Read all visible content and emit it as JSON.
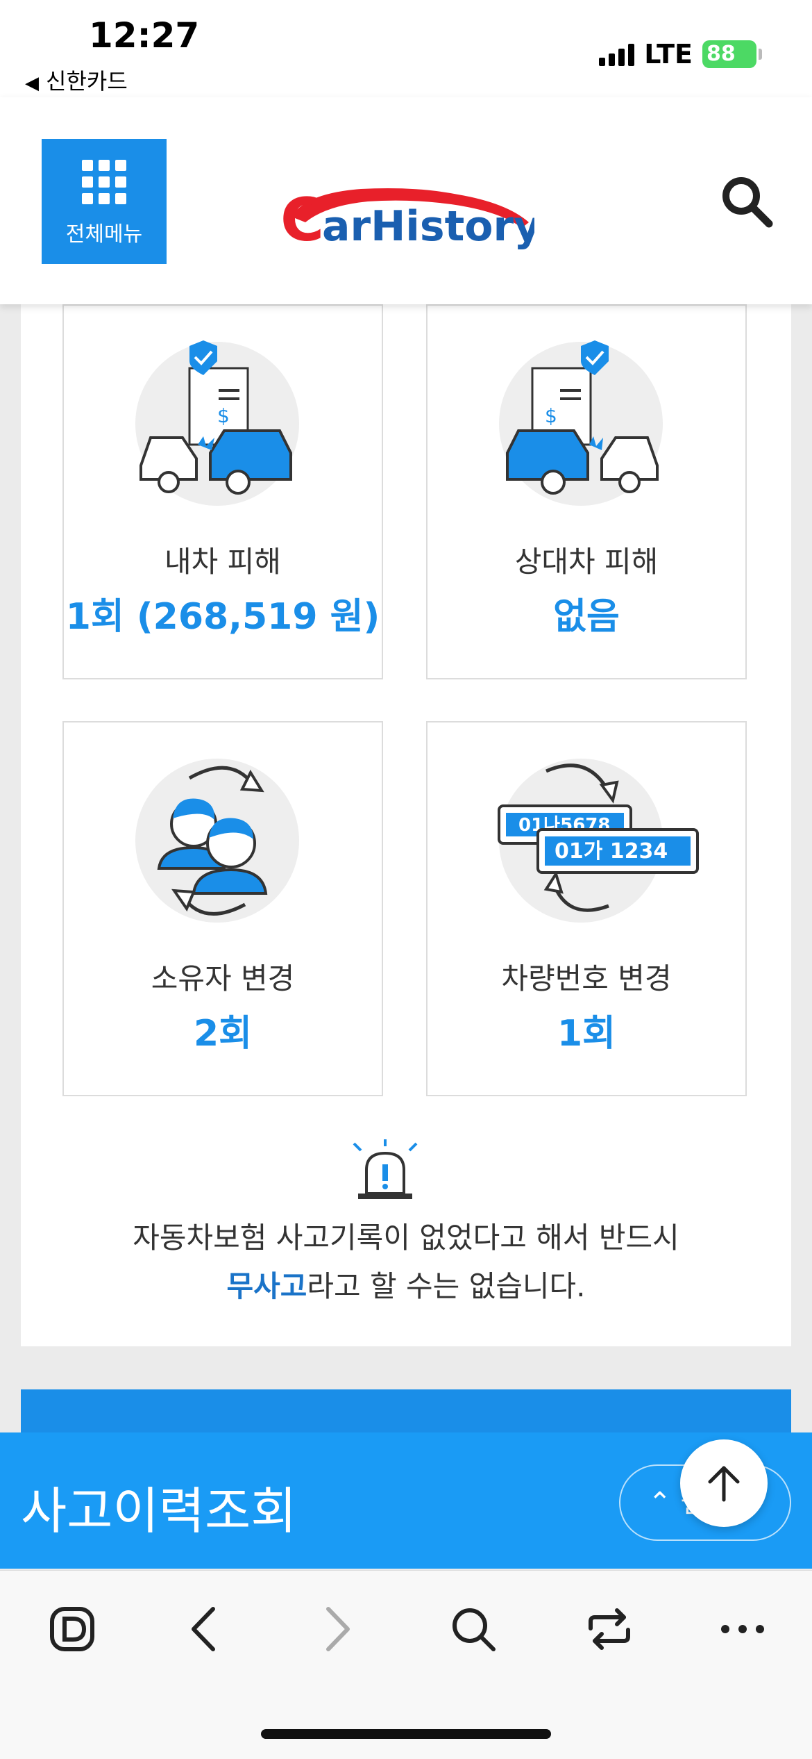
{
  "status_bar": {
    "time": "12:27",
    "back_app": "신한카드",
    "network": "LTE",
    "battery": "88"
  },
  "header": {
    "menu_label": "전체메뉴",
    "logo_text": "CarHistory"
  },
  "stats": [
    {
      "label": "내차 피해",
      "value": "1회 (268,519 원)",
      "icon": "my-car-damage-illustration"
    },
    {
      "label": "상대차 피해",
      "value": "없음",
      "icon": "other-car-damage-illustration"
    },
    {
      "label": "소유자 변경",
      "value": "2회",
      "icon": "owner-change-illustration"
    },
    {
      "label": "차량번호 변경",
      "value": "1회",
      "icon": "plate-change-illustration"
    }
  ],
  "plates": {
    "old": "01나5678",
    "new": "01가 1234"
  },
  "notice": {
    "line1": "자동차보험 사고기록이 없었다고 해서 반드시",
    "line2_emphasis": "무사고",
    "line2_rest": "라고 할 수는 없습니다."
  },
  "bottom": {
    "title": "사고이력조회",
    "pill_label": "⌃ 펼"
  },
  "colors": {
    "accent": "#1a8ee8",
    "banner": "#1a9bf5",
    "logo_red": "#e8202a"
  }
}
